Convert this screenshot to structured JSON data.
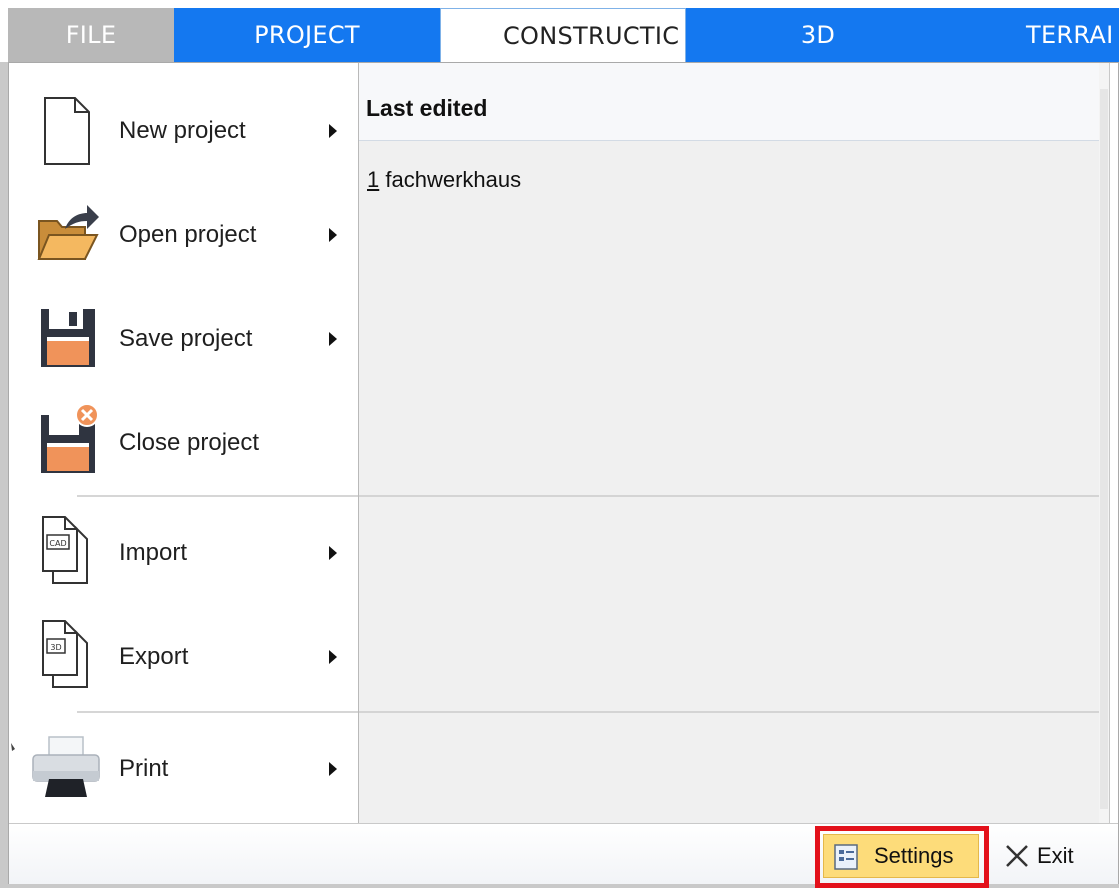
{
  "tabs": [
    {
      "label": "FILE"
    },
    {
      "label": "PROJECT"
    },
    {
      "label": "CONSTRUCTIC"
    },
    {
      "label": "3D"
    },
    {
      "label": "TERRAI"
    }
  ],
  "menu": {
    "new_project": "New project",
    "open_project": "Open project",
    "save_project": "Save project",
    "close_project": "Close project",
    "import": "Import",
    "export": "Export",
    "print": "Print"
  },
  "recent": {
    "header": "Last edited",
    "items": [
      {
        "number": "1",
        "name": " fachwerkhaus"
      }
    ]
  },
  "footer": {
    "settings_label": "Settings",
    "exit_label": "Exit"
  },
  "colors": {
    "ribbon_blue": "#1478f0",
    "file_tab_gray": "#b8b8b8",
    "settings_highlight": "#fddc7a",
    "annotation_red": "#e3111b"
  }
}
